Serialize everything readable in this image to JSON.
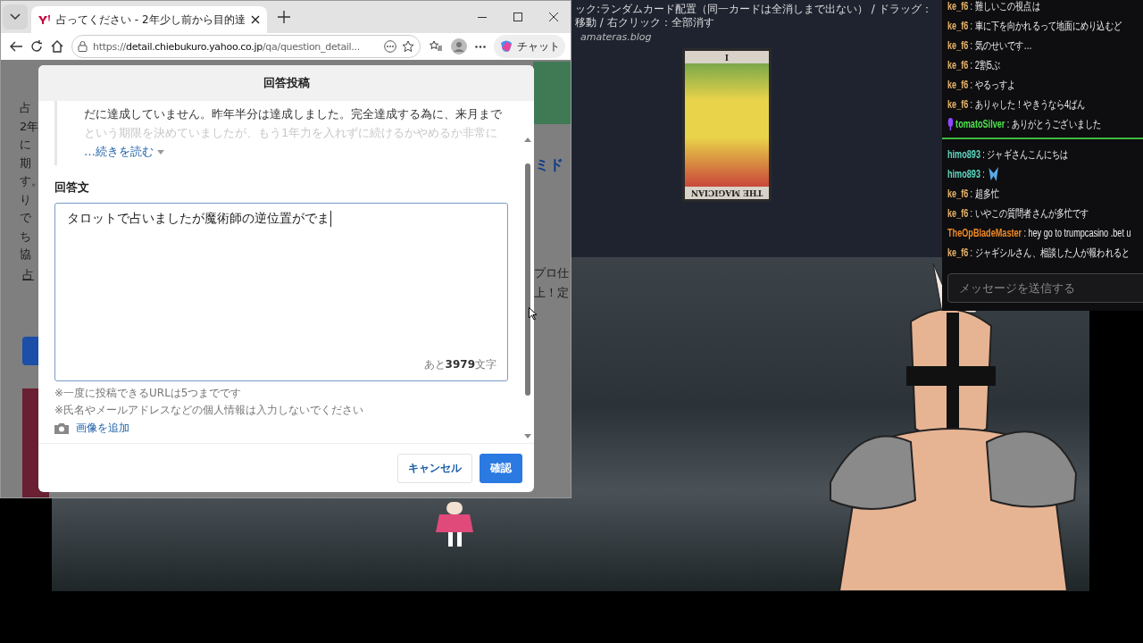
{
  "browser": {
    "tab": {
      "title": "占ってください - 2年少し前から目的達"
    },
    "url": {
      "prefix": "https://",
      "host": "detail.chiebukuro.yahoo.co.jp",
      "path": "/qa/question_detail..."
    },
    "chat_button": "チャット"
  },
  "page": {
    "left_fragments": [
      "占",
      "2年",
      "に",
      "期",
      "す。",
      "り",
      "で",
      "ち",
      "協"
    ],
    "link_fragment": "占",
    "right_heading": "ミド",
    "right_fragments": [
      "プロ仕",
      "上！定"
    ]
  },
  "modal": {
    "title": "回答投稿",
    "quote_lines": [
      "だに達成していません。昨年半分は達成しました。完全達成する為に、来月まで",
      "という期限を決めていましたが、もう1年力を入れずに続けるかやめるか非常に"
    ],
    "read_more": "…続きを読む",
    "answer_label": "回答文",
    "answer_value": "タロットで占いましたが魔術師の逆位置がでま",
    "counter": "あと**3979**文字",
    "notes": [
      "※一度に投稿できるURLは5つまでです",
      "※氏名やメールアドレスなどの個人情報は入力しないでください"
    ],
    "add_image": "画像を追加",
    "cancel": "キャンセル",
    "confirm": "確認"
  },
  "tarot": {
    "instructions": "ック:ランダムカード配置（同一カードは全消しまで出ない） / ドラッグ：移動 / 右クリック：全部消す",
    "credit": "amateras.blog",
    "card": {
      "title": "THE MAGICIAN",
      "numeral": "I",
      "reversed": true
    }
  },
  "chat": {
    "messages": [
      {
        "kind": "text",
        "user": "ke_f6",
        "color": "#e8b46a",
        "badge": false,
        "text": ": 難しいこの視点は"
      },
      {
        "kind": "text",
        "user": "ke_f6",
        "color": "#e8b46a",
        "badge": false,
        "text": ": 車に下を向かれるって地面にめり込むど"
      },
      {
        "kind": "text",
        "user": "ke_f6",
        "color": "#e8b46a",
        "badge": false,
        "text": ": 気のせいです…"
      },
      {
        "kind": "text",
        "user": "ke_f6",
        "color": "#e8b46a",
        "badge": false,
        "text": ": 2割5ぶ"
      },
      {
        "kind": "text",
        "user": "ke_f6",
        "color": "#e8b46a",
        "badge": false,
        "text": ": やるっすよ"
      },
      {
        "kind": "text",
        "user": "ke_f6",
        "color": "#e8b46a",
        "badge": false,
        "text": ": ありゃした！やきうなら4ばん"
      },
      {
        "kind": "text",
        "user": "tomatoSilver",
        "color": "#4fe34f",
        "badge": true,
        "text": ": ありがとうございました"
      },
      {
        "kind": "divider"
      },
      {
        "kind": "text",
        "user": "himo893",
        "color": "#5fd6c0",
        "badge": false,
        "text": ": ジャギさんこんにちは"
      },
      {
        "kind": "emote",
        "user": "himo893",
        "color": "#5fd6c0",
        "badge": false,
        "text": ":"
      },
      {
        "kind": "text",
        "user": "ke_f6",
        "color": "#e8b46a",
        "badge": false,
        "text": ": 超多忙"
      },
      {
        "kind": "text",
        "user": "ke_f6",
        "color": "#e8b46a",
        "badge": false,
        "text": ": いやこの質問者さんが多忙です"
      },
      {
        "kind": "text",
        "user": "TheOpBladeMaster",
        "color": "#f08a24",
        "badge": false,
        "text": ": hey go to trumpcasino .bet u"
      },
      {
        "kind": "text",
        "user": "ke_f6",
        "color": "#e8b46a",
        "badge": false,
        "text": ": ジャギシルさん、相談した人が報われると"
      }
    ],
    "placeholder": "メッセージを送信する"
  }
}
